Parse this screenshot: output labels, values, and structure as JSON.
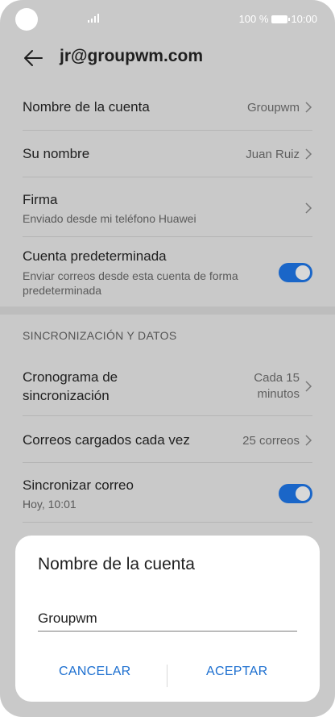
{
  "status_bar": {
    "battery_text": "100 %",
    "time": "10:00"
  },
  "header": {
    "title": "jr@groupwm.com"
  },
  "settings": {
    "account_name": {
      "label": "Nombre de la cuenta",
      "value": "Groupwm"
    },
    "your_name": {
      "label": "Su nombre",
      "value": "Juan Ruiz"
    },
    "signature": {
      "label": "Firma",
      "subtitle": "Enviado desde mi teléfono Huawei"
    },
    "default_account": {
      "label": "Cuenta predeterminada",
      "subtitle": "Enviar correos desde esta cuenta de forma predeterminada",
      "enabled": true
    },
    "sync_section_title": "SINCRONIZACIÓN Y DATOS",
    "sync_schedule": {
      "label_line1": "Cronograma de",
      "label_line2": "sincronización",
      "value_line1": "Cada 15",
      "value_line2": "minutos"
    },
    "mails_loaded": {
      "label": "Correos cargados cada vez",
      "value": "25 correos"
    },
    "sync_mail": {
      "label": "Sincronizar correo",
      "subtitle": "Hoy, 10:01",
      "enabled": true
    }
  },
  "dialog": {
    "title": "Nombre de la cuenta",
    "input_value": "Groupwm",
    "cancel_label": "CANCELAR",
    "accept_label": "ACEPTAR"
  },
  "colors": {
    "accent": "#1c6fd0",
    "toggle_on": "#1a66c8",
    "background_dimmed": "#c9c9c9"
  },
  "icons": {
    "back": "arrow-left-icon",
    "chevron": "chevron-right-icon"
  }
}
